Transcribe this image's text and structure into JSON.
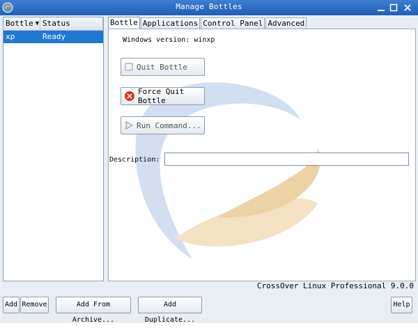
{
  "window": {
    "title": "Manage Bottles"
  },
  "bottle_list": {
    "columns": [
      "Bottle",
      "Status"
    ],
    "rows": [
      {
        "bottle": "xp",
        "status": "Ready"
      }
    ]
  },
  "tabs": [
    {
      "label": "Bottle",
      "active": true
    },
    {
      "label": "Applications",
      "active": false
    },
    {
      "label": "Control Panel",
      "active": false
    },
    {
      "label": "Advanced",
      "active": false
    }
  ],
  "bottle_tab": {
    "windows_version_label": "Windows version:",
    "windows_version_value": "winxp",
    "quit_label": "Quit Bottle",
    "force_quit_label": "Force Quit Bottle",
    "run_command_label": "Run Command...",
    "description_label": "Description:",
    "description_value": ""
  },
  "version_text": "CrossOver Linux Professional 9.0.0",
  "bottom_buttons": {
    "add": "Add",
    "remove": "Remove",
    "add_from_archive": "Add From Archive...",
    "add_duplicate": "Add Duplicate...",
    "help": "Help"
  },
  "colors": {
    "titlebar": "#2a6cc4",
    "selection": "#1f78d1",
    "force_quit_icon": "#d9362b"
  }
}
